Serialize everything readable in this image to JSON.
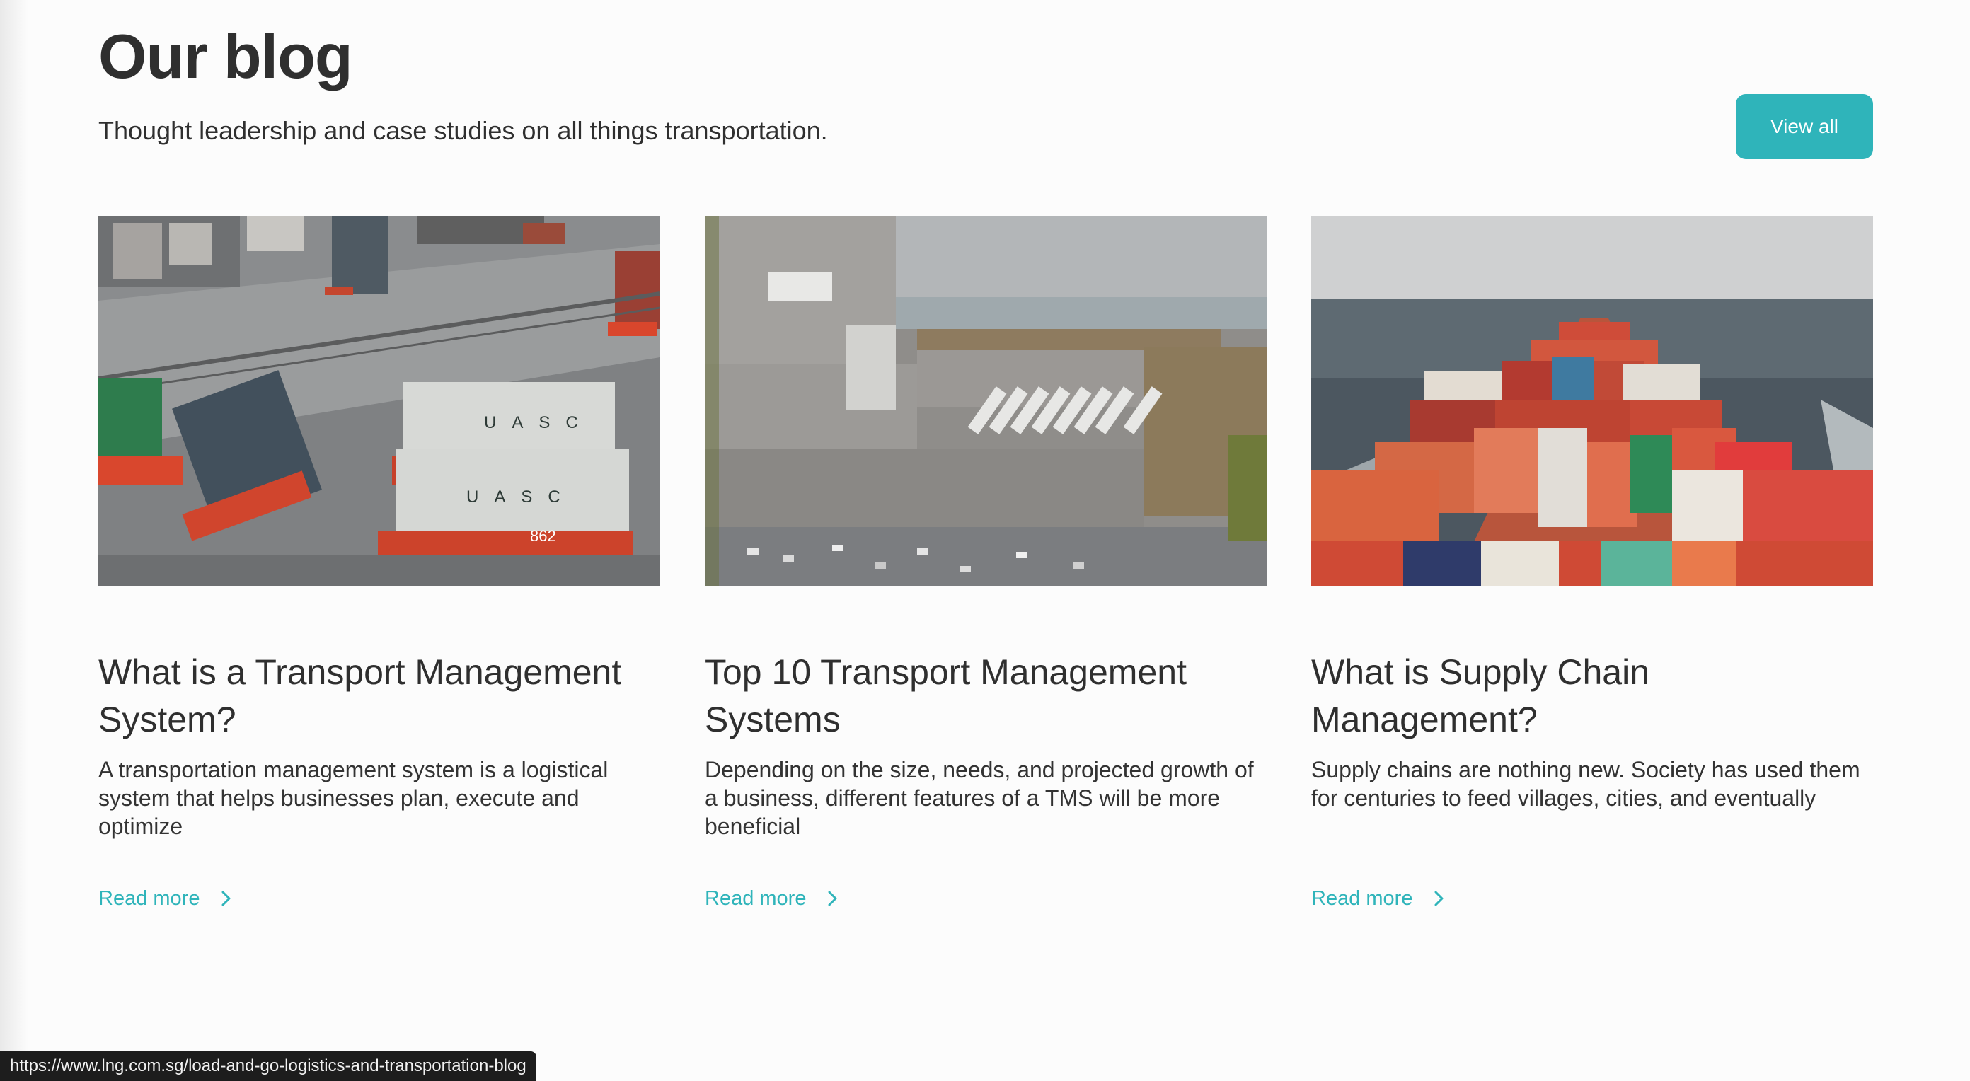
{
  "header": {
    "title": "Our blog",
    "subtitle": "Thought leadership and case studies on all things transportation.",
    "view_all_label": "View all"
  },
  "accent_color": "#2fb4ba",
  "posts": [
    {
      "title": "What is a Transport Management System?",
      "excerpt": "A transportation management system is a logistical system that helps businesses plan, execute and optimize",
      "read_more": "Read more",
      "image": "container-port-aerial-photo"
    },
    {
      "title": "Top 10 Transport Management Systems",
      "excerpt": "Depending on the size, needs, and projected growth of a business, different features of a TMS will be more beneficial",
      "read_more": "Read more",
      "image": "warehouse-truck-yard-aerial-photo"
    },
    {
      "title": "What is Supply Chain Management?",
      "excerpt": "Supply chains are nothing new. Society has used them for centuries to feed villages, cities, and eventually",
      "read_more": "Read more",
      "image": "container-ship-at-sea-photo"
    }
  ],
  "status_bar": {
    "url": "https://www.lng.com.sg/load-and-go-logistics-and-transportation-blog"
  }
}
